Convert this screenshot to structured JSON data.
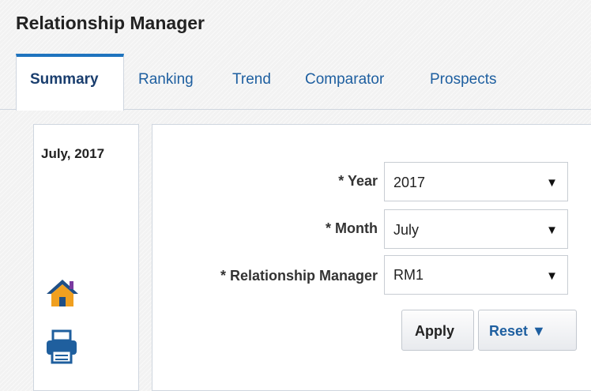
{
  "app": {
    "title": "Relationship Manager"
  },
  "tabs": [
    {
      "label": "Summary",
      "active": true
    },
    {
      "label": "Ranking",
      "active": false
    },
    {
      "label": "Trend",
      "active": false
    },
    {
      "label": "Comparator",
      "active": false
    },
    {
      "label": "Prospects",
      "active": false
    }
  ],
  "summary": {
    "period": "July, 2017"
  },
  "icons": {
    "home": "home-icon",
    "print": "print-icon"
  },
  "form": {
    "year": {
      "label": "* Year",
      "value": "2017"
    },
    "month": {
      "label": "* Month",
      "value": "July"
    },
    "manager": {
      "label": "* Relationship Manager",
      "value": "RM1"
    }
  },
  "buttons": {
    "apply": "Apply",
    "reset": "Reset ▼"
  },
  "colors": {
    "tab_accent": "#1e73be",
    "link": "#1e5fa0",
    "home_icon": "#f0a020",
    "print_icon": "#1f5f9e"
  }
}
